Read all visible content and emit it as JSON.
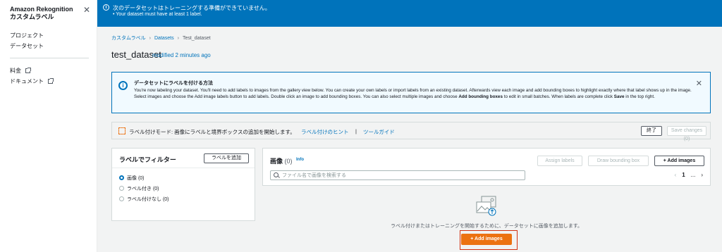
{
  "sidebar": {
    "title_line1": "Amazon Rekognition",
    "title_line2": "カスタムラベル",
    "close": "✕",
    "items": [
      {
        "label": "プロジェクト"
      },
      {
        "label": "データセット"
      }
    ],
    "external_links": [
      {
        "label": "料金"
      },
      {
        "label": "ドキュメント"
      }
    ]
  },
  "flash": {
    "title": "次のデータセットはトレーニングする準備ができていません。",
    "items": [
      "Your dataset must have at least 1 label."
    ]
  },
  "breadcrumb": {
    "items": [
      "カスタムラベル",
      "Datasets",
      "Test_dataset"
    ],
    "separator": "›"
  },
  "header": {
    "title": "test_dataset",
    "subtitle": "modified 2 minutes ago"
  },
  "info_box": {
    "title": "データセットにラベルを付ける方法",
    "body_1": "You're now labeling your dataset. You'll need to add labels to images from the gallery view below. You can create your own labels or import labels from an existing dataset. Afterwards view each image and add bounding boxes to highlight exactly where that label shows up in the image. Select images and choose the Add image labels button to add labels. Double click an image to add bounding boxes. You can also select multiple images and choose ",
    "body_bold_1": "Add bounding boxes",
    "body_2": " to edit in small batches. When labels are complete click ",
    "body_bold_2": "Save",
    "body_3": " in the top right.",
    "close": "✕"
  },
  "mode_bar": {
    "text": "ラベル付けモード: 画像にラベルと境界ボックスの追加を開始します。",
    "link_hints": "ラベル付けのヒント",
    "pipe": "|",
    "link_tool_guide": "ツールガイド",
    "exit_button": "終了",
    "save_button": "Save changes (0)"
  },
  "filter_panel": {
    "title": "ラベルでフィルター",
    "add_label_button": "ラベルを追加",
    "options": [
      {
        "label": "画像 (0)",
        "selected": true
      },
      {
        "label": "ラベル付き (0)",
        "selected": false
      },
      {
        "label": "ラベル付けなし (0)",
        "selected": false
      }
    ]
  },
  "images_panel": {
    "title": "画像",
    "count": "(0)",
    "info": "Info",
    "assign_labels_button": "Assign labels",
    "draw_bbox_button": "Draw bounding box",
    "add_images_button": "+ Add images",
    "search_placeholder": "ファイル名で画像を検索する",
    "pager": {
      "prev": "‹",
      "page": "1",
      "ellipsis": "...",
      "next": "›"
    },
    "empty_text": "ラベル付けまたはトレーニングを開始するために、データセットに画像を追加します。",
    "empty_add_button": "+ Add images"
  },
  "colors": {
    "accent": "#0073bb",
    "primary_button": "#ec7211",
    "highlight_box": "#d13212"
  }
}
